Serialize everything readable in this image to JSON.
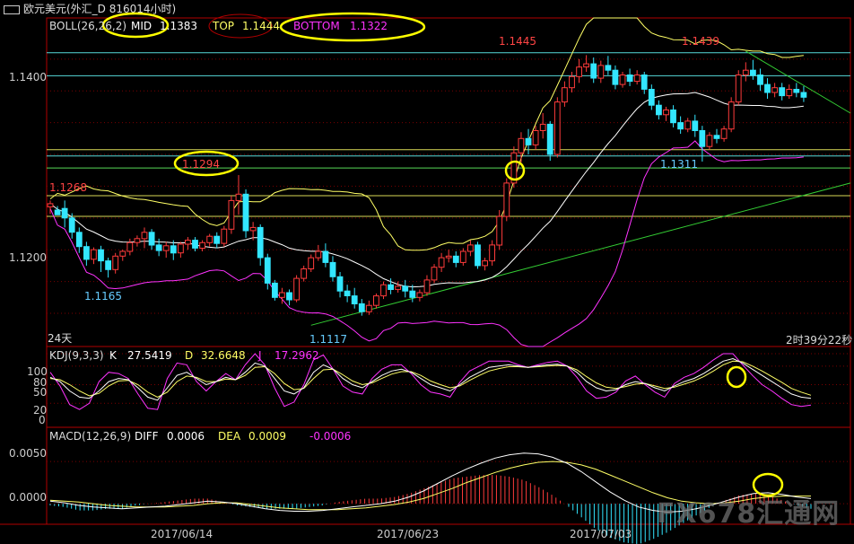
{
  "window": {
    "title": "欧元美元(外汇_D 816014小时)"
  },
  "colors": {
    "frame": "#b00000",
    "up": "#ff3b3b",
    "down": "#33e6ff",
    "mid": "#ffffff",
    "top": "#ffff66",
    "bottom": "#ff33ff",
    "hline_cyan": "#66ffff",
    "hline_yellow": "#ffff66",
    "hline_green": "#66ff66",
    "trend_green": "#33cc33",
    "k": "#ffffff",
    "d": "#ffff66",
    "j": "#ff33ff",
    "annotation": "#ffff00",
    "price_label_red": "#ff4444",
    "price_label_cyan": "#66ccff"
  },
  "main_panel": {
    "indicator_name": "BOLL(26,26,2)",
    "mid_label": "MID",
    "mid_value": "1.1383",
    "top_label": "TOP",
    "top_value": "1.1444",
    "bottom_label": "BOTTOM",
    "bottom_value": "1.1322",
    "y_ticks": [
      "1.1400",
      "1.1200"
    ],
    "period_label": "24天",
    "countdown": "2时39分22秒",
    "price_labels": [
      {
        "text": "1.1268",
        "color": "red"
      },
      {
        "text": "1.1294",
        "color": "red"
      },
      {
        "text": "1.1165",
        "color": "cyan"
      },
      {
        "text": "1.1117",
        "color": "cyan"
      },
      {
        "text": "1.1445",
        "color": "red"
      },
      {
        "text": "1.1439",
        "color": "red"
      },
      {
        "text": "1.1311",
        "color": "cyan"
      }
    ]
  },
  "kdj_panel": {
    "indicator_name": "KDJ(9,3,3)",
    "k_label": "K",
    "k_value": "27.5419",
    "d_label": "D",
    "d_value": "32.6648",
    "j_label": "J",
    "j_value": "17.2962",
    "y_ticks": [
      "100",
      "80",
      "50",
      "20",
      "0"
    ]
  },
  "macd_panel": {
    "indicator_name": "MACD(12,26,9)",
    "diff_label": "DIFF",
    "diff_value": "0.0006",
    "dea_label": "DEA",
    "dea_value": "0.0009",
    "macd_value": "-0.0006",
    "y_ticks": [
      "0.0050",
      "0.0000"
    ]
  },
  "x_axis": {
    "dates": [
      "2017/06/14",
      "2017/06/23",
      "2017/07/03"
    ]
  },
  "watermark": {
    "text": "FX678汇通网"
  },
  "chart_data": {
    "type": "candlestick",
    "symbol": "欧元美元",
    "interval": "4小时",
    "y_range": [
      1.1085,
      1.1485
    ],
    "boll": {
      "period": 26,
      "width": 2,
      "mid": 1.1383,
      "top": 1.1444,
      "bottom": 1.1322
    },
    "annotated_highs": [
      1.1294,
      1.1268,
      1.1445,
      1.1439
    ],
    "annotated_lows": [
      1.1165,
      1.1117,
      1.1311
    ],
    "horizontal_levels": [
      1.1448,
      1.1419,
      1.1326,
      1.1318,
      1.1303,
      1.1268,
      1.1242
    ],
    "candles": [
      [
        1.1254,
        1.1262,
        1.1258,
        1.1245
      ],
      [
        1.125,
        1.1255,
        1.1244,
        1.1246
      ],
      [
        1.1252,
        1.1262,
        1.124,
        1.1228
      ],
      [
        1.124,
        1.1246,
        1.1222,
        1.1214
      ],
      [
        1.1222,
        1.1228,
        1.1204,
        1.1196
      ],
      [
        1.1204,
        1.121,
        1.1188,
        1.118
      ],
      [
        1.1188,
        1.1203,
        1.12,
        1.1182
      ],
      [
        1.12,
        1.1205,
        1.1186,
        1.1172
      ],
      [
        1.1186,
        1.119,
        1.1175,
        1.1165
      ],
      [
        1.1175,
        1.1196,
        1.1192,
        1.117
      ],
      [
        1.1192,
        1.12,
        1.1198,
        1.1186
      ],
      [
        1.1198,
        1.1214,
        1.1209,
        1.1193
      ],
      [
        1.1209,
        1.1218,
        1.1214,
        1.1204
      ],
      [
        1.1214,
        1.1228,
        1.1222,
        1.1202
      ],
      [
        1.1222,
        1.1226,
        1.1206,
        1.12
      ],
      [
        1.1206,
        1.1214,
        1.1199,
        1.1192
      ],
      [
        1.1199,
        1.121,
        1.1205,
        1.119
      ],
      [
        1.1205,
        1.1212,
        1.1196,
        1.1187
      ],
      [
        1.1196,
        1.121,
        1.1207,
        1.119
      ],
      [
        1.1207,
        1.1216,
        1.1212,
        1.12
      ],
      [
        1.1212,
        1.1216,
        1.1202,
        1.1198
      ],
      [
        1.1202,
        1.1212,
        1.1209,
        1.1198
      ],
      [
        1.1209,
        1.122,
        1.1217,
        1.1204
      ],
      [
        1.1217,
        1.1222,
        1.1208,
        1.1202
      ],
      [
        1.1208,
        1.123,
        1.1226,
        1.1204
      ],
      [
        1.1226,
        1.1268,
        1.1262,
        1.122
      ],
      [
        1.1262,
        1.1294,
        1.127,
        1.1244
      ],
      [
        1.127,
        1.1276,
        1.1224,
        1.1215
      ],
      [
        1.1224,
        1.1235,
        1.1228,
        1.1212
      ],
      [
        1.1228,
        1.1232,
        1.119,
        1.118
      ],
      [
        1.119,
        1.1195,
        1.1158,
        1.115
      ],
      [
        1.1158,
        1.1162,
        1.114,
        1.1136
      ],
      [
        1.114,
        1.1152,
        1.1146,
        1.1132
      ],
      [
        1.1146,
        1.115,
        1.1137,
        1.113
      ],
      [
        1.1137,
        1.1168,
        1.1164,
        1.1134
      ],
      [
        1.1164,
        1.118,
        1.1176,
        1.116
      ],
      [
        1.1176,
        1.1194,
        1.119,
        1.1172
      ],
      [
        1.119,
        1.1206,
        1.1198,
        1.1186
      ],
      [
        1.1198,
        1.1208,
        1.1184,
        1.1178
      ],
      [
        1.1184,
        1.1192,
        1.1166,
        1.116
      ],
      [
        1.1166,
        1.1172,
        1.1148,
        1.114
      ],
      [
        1.1148,
        1.1156,
        1.1142,
        1.1134
      ],
      [
        1.1142,
        1.1152,
        1.1132,
        1.1126
      ],
      [
        1.1132,
        1.1138,
        1.1122,
        1.1117
      ],
      [
        1.1122,
        1.1136,
        1.113,
        1.1118
      ],
      [
        1.113,
        1.1145,
        1.1142,
        1.1126
      ],
      [
        1.1142,
        1.116,
        1.1156,
        1.1138
      ],
      [
        1.1156,
        1.1164,
        1.115,
        1.1144
      ],
      [
        1.115,
        1.116,
        1.1154,
        1.1146
      ],
      [
        1.1154,
        1.1162,
        1.1148,
        1.114
      ],
      [
        1.1148,
        1.1156,
        1.114,
        1.1134
      ],
      [
        1.114,
        1.115,
        1.1146,
        1.1135
      ],
      [
        1.1146,
        1.1168,
        1.1162,
        1.1142
      ],
      [
        1.1162,
        1.1182,
        1.1178,
        1.1158
      ],
      [
        1.1178,
        1.1196,
        1.119,
        1.1172
      ],
      [
        1.119,
        1.12,
        1.1192,
        1.1184
      ],
      [
        1.1192,
        1.1198,
        1.1184,
        1.1178
      ],
      [
        1.1184,
        1.1202,
        1.1198,
        1.118
      ],
      [
        1.1198,
        1.1212,
        1.1206,
        1.1192
      ],
      [
        1.1206,
        1.121,
        1.118,
        1.1176
      ],
      [
        1.118,
        1.119,
        1.1186,
        1.1174
      ],
      [
        1.1186,
        1.1212,
        1.1206,
        1.118
      ],
      [
        1.1206,
        1.125,
        1.1242,
        1.12
      ],
      [
        1.1242,
        1.129,
        1.1284,
        1.1236
      ],
      [
        1.1284,
        1.133,
        1.1322,
        1.1278
      ],
      [
        1.1322,
        1.1348,
        1.134,
        1.131
      ],
      [
        1.134,
        1.1352,
        1.1332,
        1.132
      ],
      [
        1.1332,
        1.1356,
        1.135,
        1.1326
      ],
      [
        1.135,
        1.1372,
        1.1358,
        1.134
      ],
      [
        1.1358,
        1.1362,
        1.132,
        1.1312
      ],
      [
        1.132,
        1.1392,
        1.1386,
        1.1316
      ],
      [
        1.1386,
        1.1412,
        1.1404,
        1.138
      ],
      [
        1.1404,
        1.1424,
        1.1418,
        1.1398
      ],
      [
        1.1418,
        1.144,
        1.143,
        1.141
      ],
      [
        1.143,
        1.1445,
        1.1434,
        1.1424
      ],
      [
        1.1434,
        1.1442,
        1.1416,
        1.141
      ],
      [
        1.1416,
        1.1438,
        1.1432,
        1.141
      ],
      [
        1.1432,
        1.1444,
        1.1426,
        1.142
      ],
      [
        1.1426,
        1.1432,
        1.1408,
        1.1402
      ],
      [
        1.1408,
        1.1424,
        1.142,
        1.1404
      ],
      [
        1.142,
        1.1428,
        1.1412,
        1.1406
      ],
      [
        1.1412,
        1.1426,
        1.142,
        1.1408
      ],
      [
        1.142,
        1.1424,
        1.1402,
        1.1396
      ],
      [
        1.1402,
        1.1408,
        1.1382,
        1.1376
      ],
      [
        1.1382,
        1.1388,
        1.137,
        1.1364
      ],
      [
        1.137,
        1.138,
        1.1376,
        1.1362
      ],
      [
        1.1376,
        1.1382,
        1.136,
        1.1354
      ],
      [
        1.136,
        1.1368,
        1.1352,
        1.1346
      ],
      [
        1.1352,
        1.1366,
        1.1362,
        1.1348
      ],
      [
        1.1362,
        1.137,
        1.135,
        1.1342
      ],
      [
        1.135,
        1.1356,
        1.133,
        1.1311
      ],
      [
        1.133,
        1.1348,
        1.1344,
        1.1326
      ],
      [
        1.1344,
        1.1352,
        1.134,
        1.1334
      ],
      [
        1.134,
        1.1356,
        1.1352,
        1.1336
      ],
      [
        1.1352,
        1.1392,
        1.1386,
        1.1348
      ],
      [
        1.1386,
        1.1426,
        1.142,
        1.1382
      ],
      [
        1.142,
        1.1436,
        1.1426,
        1.1412
      ],
      [
        1.1426,
        1.1439,
        1.142,
        1.1414
      ],
      [
        1.142,
        1.1428,
        1.1408,
        1.14
      ],
      [
        1.1408,
        1.1416,
        1.1398,
        1.139
      ],
      [
        1.1398,
        1.141,
        1.1404,
        1.1392
      ],
      [
        1.1404,
        1.141,
        1.1394,
        1.1388
      ],
      [
        1.1394,
        1.1408,
        1.1402,
        1.139
      ],
      [
        1.1402,
        1.141,
        1.1398,
        1.1392
      ],
      [
        1.1398,
        1.1406,
        1.1392,
        1.1386
      ]
    ],
    "kdj": {
      "k": [
        62,
        55,
        40,
        30,
        28,
        40,
        55,
        60,
        58,
        45,
        30,
        25,
        45,
        65,
        70,
        60,
        50,
        55,
        62,
        58,
        70,
        85,
        80,
        60,
        40,
        35,
        45,
        70,
        82,
        75,
        60,
        50,
        45,
        55,
        65,
        72,
        75,
        70,
        60,
        50,
        45,
        40,
        50,
        62,
        70,
        78,
        80,
        82,
        80,
        78,
        80,
        82,
        83,
        80,
        70,
        55,
        45,
        40,
        42,
        50,
        55,
        52,
        45,
        40,
        48,
        55,
        60,
        68,
        78,
        88,
        92,
        85,
        75,
        65,
        55,
        45,
        35,
        30,
        28
      ],
      "d": [
        60,
        58,
        50,
        40,
        32,
        36,
        48,
        56,
        57,
        50,
        38,
        30,
        38,
        55,
        64,
        62,
        55,
        55,
        59,
        58,
        65,
        78,
        79,
        68,
        52,
        42,
        44,
        60,
        74,
        75,
        66,
        56,
        50,
        53,
        60,
        67,
        71,
        71,
        65,
        56,
        50,
        45,
        48,
        57,
        65,
        72,
        76,
        79,
        79,
        78,
        79,
        80,
        81,
        80,
        74,
        63,
        53,
        46,
        44,
        47,
        51,
        52,
        48,
        44,
        46,
        51,
        56,
        63,
        72,
        82,
        88,
        87,
        80,
        72,
        63,
        54,
        44,
        38,
        33
      ],
      "j": [
        70,
        48,
        18,
        10,
        20,
        55,
        70,
        68,
        60,
        35,
        12,
        10,
        60,
        85,
        82,
        55,
        40,
        55,
        68,
        58,
        82,
        100,
        82,
        45,
        15,
        22,
        50,
        90,
        98,
        75,
        48,
        38,
        35,
        60,
        75,
        82,
        82,
        68,
        50,
        38,
        35,
        30,
        54,
        72,
        80,
        88,
        88,
        88,
        82,
        78,
        82,
        86,
        88,
        80,
        62,
        40,
        28,
        30,
        38,
        56,
        64,
        50,
        38,
        30,
        52,
        62,
        68,
        78,
        90,
        100,
        100,
        82,
        65,
        50,
        40,
        28,
        18,
        15,
        17
      ]
    },
    "macd": {
      "diff": [
        0.0003,
        0.0001,
        -0.0002,
        -0.0004,
        -0.0005,
        -0.0006,
        -0.0005,
        -0.0004,
        -0.0003,
        -0.0001,
        0.0001,
        0.0003,
        0.0002,
        0.0,
        -0.0003,
        -0.0006,
        -0.0008,
        -0.0009,
        -0.0009,
        -0.0008,
        -0.0006,
        -0.0004,
        -0.0002,
        0.0,
        0.0003,
        0.0008,
        0.0015,
        0.0024,
        0.0033,
        0.0041,
        0.0048,
        0.0054,
        0.0058,
        0.006,
        0.0059,
        0.0055,
        0.0048,
        0.0038,
        0.0026,
        0.0014,
        0.0004,
        -0.0004,
        -0.0008,
        -0.001,
        -0.0009,
        -0.0006,
        -0.0002,
        0.0003,
        0.0008,
        0.0012,
        0.0013,
        0.0011,
        0.0008,
        0.0006
      ],
      "dea": [
        0.0004,
        0.0003,
        0.0002,
        0.0,
        -0.0002,
        -0.0003,
        -0.0004,
        -0.0004,
        -0.0004,
        -0.0003,
        -0.0002,
        0.0,
        0.0001,
        0.0001,
        -0.0001,
        -0.0003,
        -0.0005,
        -0.0006,
        -0.0007,
        -0.0007,
        -0.0007,
        -0.0006,
        -0.0005,
        -0.0003,
        -0.0001,
        0.0002,
        0.0006,
        0.0012,
        0.0018,
        0.0025,
        0.0031,
        0.0037,
        0.0042,
        0.0046,
        0.0049,
        0.005,
        0.0049,
        0.0046,
        0.0041,
        0.0034,
        0.0027,
        0.002,
        0.0013,
        0.0007,
        0.0003,
        0.0001,
        0.0,
        0.0001,
        0.0003,
        0.0006,
        0.0008,
        0.0009,
        0.0009,
        0.0009
      ]
    }
  }
}
